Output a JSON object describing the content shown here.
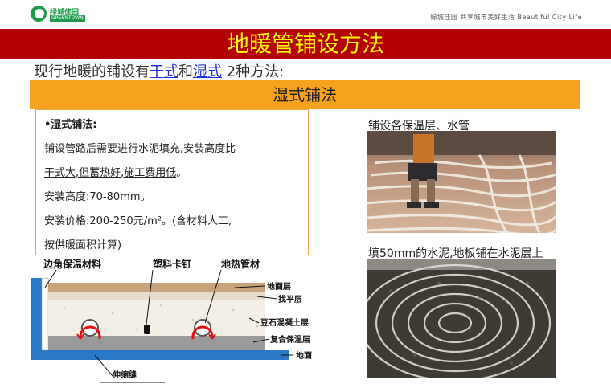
{
  "header": {
    "logo_cn": "绿城佳园",
    "logo_en": "GREENTOWN",
    "tagline": "绿城佳园  共享城市美好生活  Beautiful City Life"
  },
  "title": "地暖管铺设方法",
  "intro": {
    "prefix": "现行地暖的铺设有",
    "link1": "干式",
    "mid": "和",
    "link2": "湿式",
    "suffix": " 2种方法:"
  },
  "section_title": "湿式铺法",
  "textbox": {
    "heading": "•湿式铺法:",
    "line1_a": "铺设管路后需要进行水泥填充,",
    "line1_b": "安装高度比",
    "line2": "干式大,但蓄热好,施工费用低",
    "line2_end": "。",
    "line3": "安装高度:70-80mm。",
    "line4": "安装价格:200-250元/m²。(含材料人工,",
    "line5": "按供暖面积计算)"
  },
  "photos": {
    "caption1": "铺设各保温层、水管",
    "caption2": "填50mm的水泥,地板铺在水泥层上"
  },
  "diagram": {
    "labels": {
      "edge_insulation": "边角保温材料",
      "plastic_nail": "塑料卡钉",
      "heating_pipe": "地热管材",
      "floor_layer": "地面层",
      "leveling_layer": "找平层",
      "pebble_concrete": "豆石混凝土层",
      "composite_insulation": "复合保温层",
      "ground": "地面",
      "expansion_joint": "伸缩缝"
    },
    "colors": {
      "floor": "#c9a27a",
      "concrete": "#f3efe6",
      "insulation": "#9a9a9a",
      "wall": "#2a78c8",
      "pipe_arrow": "#e01010"
    }
  }
}
